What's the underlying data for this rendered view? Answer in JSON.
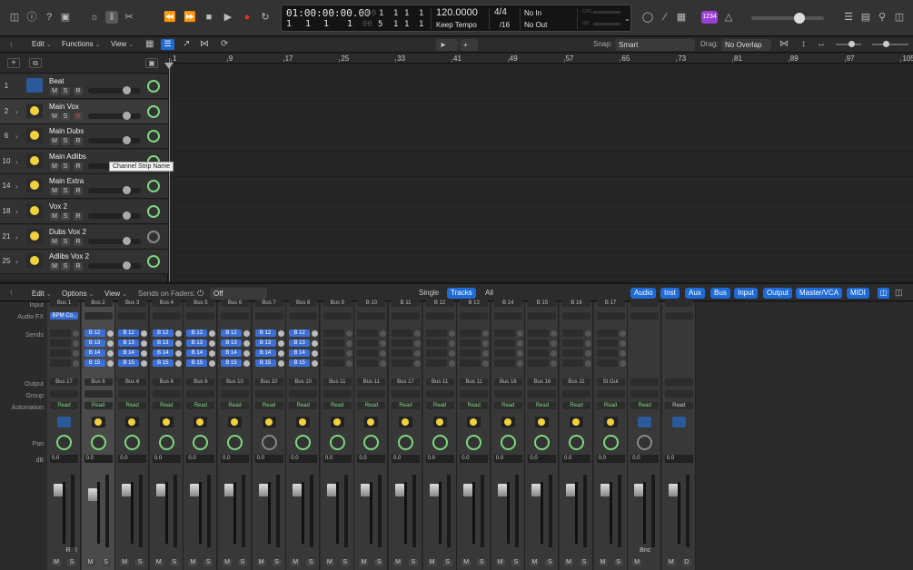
{
  "control_bar": {
    "lcd": {
      "smpte": "01:00:00:00.00",
      "smpte_dim": "000",
      "smpte_small": [
        "1",
        "1",
        "1",
        "1"
      ],
      "bars_dim": "000",
      "bars": [
        "1",
        "1",
        "1",
        "1"
      ],
      "bars_small_dim": "00",
      "bars_small": [
        "5",
        "1",
        "1",
        "1"
      ],
      "tempo": "120.0000",
      "tempo_mode": "Keep Tempo",
      "time_sig": "4/4",
      "division": "/16",
      "in": "No In",
      "out": "No Out",
      "cpu_labels": [
        "CPU",
        "HD"
      ]
    },
    "cpu_badge": "1234"
  },
  "arrange_toolbar": {
    "edit": "Edit",
    "functions": "Functions",
    "view": "View",
    "snap_label": "Snap:",
    "snap_value": "Smart",
    "drag_label": "Drag:",
    "drag_value": "No Overlap"
  },
  "ruler": {
    "bars": [
      "1",
      "9",
      "17",
      "25",
      "33",
      "41",
      "49",
      "57",
      "65",
      "73",
      "81",
      "89",
      "97",
      "105"
    ]
  },
  "tracks": [
    {
      "num": "1",
      "name": "Beat",
      "icon": "waveform",
      "selected": false
    },
    {
      "num": "2",
      "name": "Main Vox",
      "icon": "mic",
      "selected": true
    },
    {
      "num": "6",
      "name": "Main Dubs",
      "icon": "mic",
      "selected": false
    },
    {
      "num": "10",
      "name": "Main Adlibs",
      "icon": "mic",
      "selected": false
    },
    {
      "num": "14",
      "name": "Main Extra",
      "icon": "mic",
      "selected": false
    },
    {
      "num": "18",
      "name": "Vox 2",
      "icon": "mic",
      "selected": false
    },
    {
      "num": "21",
      "name": "Dubs Vox 2",
      "icon": "mic",
      "selected": false
    },
    {
      "num": "25",
      "name": "Adlibs Vox 2",
      "icon": "mic",
      "selected": false
    }
  ],
  "track_buttons": {
    "mute": "M",
    "solo": "S",
    "record": "R"
  },
  "tooltip": "Channel Strip Name",
  "mixer_toolbar": {
    "edit": "Edit",
    "options": "Options",
    "view": "View",
    "sends_on_faders_label": "Sends on Faders:",
    "sends_on_faders_value": "Off",
    "scope": [
      "Single",
      "Tracks",
      "All"
    ],
    "scope_active": "Tracks",
    "filters": [
      "Audio",
      "Inst",
      "Aux",
      "Bus",
      "Input",
      "Output",
      "Master/VCA",
      "MIDI"
    ]
  },
  "mixer_labels": [
    "Input",
    "Audio FX",
    "Sends",
    "Output",
    "Group",
    "Automation",
    "Pan",
    "dB"
  ],
  "strips": [
    {
      "input": "Bus 1",
      "fx": "BPM Co..",
      "sends": [],
      "output": "Bus 17",
      "auto": "Read",
      "icon": "waveform",
      "pan_active": true,
      "db": "0.0",
      "bottom": [
        "M",
        "S"
      ],
      "ri": true
    },
    {
      "input": "Bus 2",
      "fx": "",
      "sends": [
        "B 12",
        "B 13",
        "B 14",
        "B 15"
      ],
      "output": "Bus 6",
      "auto": "Read",
      "icon": "mic",
      "pan_active": true,
      "db": "0.0",
      "bottom": [
        "M",
        "S"
      ],
      "selected": true
    },
    {
      "input": "Bus 3",
      "fx": "",
      "sends": [
        "B 12",
        "B 13",
        "B 14",
        "B 15"
      ],
      "output": "Bus 6",
      "auto": "Read",
      "icon": "mic",
      "pan_active": true,
      "db": "0.0",
      "bottom": [
        "M",
        "S"
      ]
    },
    {
      "input": "Bus 4",
      "fx": "",
      "sends": [
        "B 12",
        "B 13",
        "B 14",
        "B 15"
      ],
      "output": "Bus 6",
      "auto": "Read",
      "icon": "mic",
      "pan_active": true,
      "db": "0.0",
      "bottom": [
        "M",
        "S"
      ]
    },
    {
      "input": "Bus 5",
      "fx": "",
      "sends": [
        "B 12",
        "B 13",
        "B 14",
        "B 15"
      ],
      "output": "Bus 6",
      "auto": "Read",
      "icon": "mic",
      "pan_active": true,
      "db": "0.0",
      "bottom": [
        "M",
        "S"
      ]
    },
    {
      "input": "Bus 6",
      "fx": "",
      "sends": [
        "B 12",
        "B 13",
        "B 14",
        "B 15"
      ],
      "output": "Bus 10",
      "auto": "Read",
      "icon": "mic",
      "pan_active": true,
      "db": "0.0",
      "bottom": [
        "M",
        "S"
      ]
    },
    {
      "input": "Bus 7",
      "fx": "",
      "sends": [
        "B 12",
        "B 13",
        "B 14",
        "B 15"
      ],
      "output": "Bus 10",
      "auto": "Read",
      "icon": "mic",
      "pan_active": false,
      "db": "0.0",
      "bottom": [
        "M",
        "S"
      ]
    },
    {
      "input": "Bus 8",
      "fx": "",
      "sends": [
        "B 12",
        "B 13",
        "B 14",
        "B 15"
      ],
      "output": "Bus 10",
      "auto": "Read",
      "icon": "mic",
      "pan_active": true,
      "db": "0.0",
      "bottom": [
        "M",
        "S"
      ]
    },
    {
      "input": "Bus 9",
      "fx": "",
      "sends": [],
      "output": "Bus 11",
      "auto": "Read",
      "icon": "mic",
      "pan_active": true,
      "db": "0.0",
      "bottom": [
        "M",
        "S"
      ]
    },
    {
      "input": "B 10",
      "fx": "",
      "sends": [],
      "output": "Bus 11",
      "auto": "Read",
      "icon": "mic",
      "pan_active": true,
      "db": "0.0",
      "bottom": [
        "M",
        "S"
      ]
    },
    {
      "input": "B 11",
      "fx": "",
      "sends": [],
      "output": "Bus 17",
      "auto": "Read",
      "icon": "mic",
      "pan_active": true,
      "db": "0.0",
      "bottom": [
        "M",
        "S"
      ]
    },
    {
      "input": "B 12",
      "fx": "",
      "sends": [],
      "output": "Bus 11",
      "auto": "Read",
      "icon": "mic",
      "pan_active": true,
      "db": "0.0",
      "bottom": [
        "M",
        "S"
      ]
    },
    {
      "input": "B 13",
      "fx": "",
      "sends": [],
      "output": "Bus 11",
      "auto": "Read",
      "icon": "mic",
      "pan_active": true,
      "db": "0.0",
      "bottom": [
        "M",
        "S"
      ]
    },
    {
      "input": "B 14",
      "fx": "",
      "sends": [],
      "output": "Bus 16",
      "auto": "Read",
      "icon": "mic",
      "pan_active": true,
      "db": "0.0",
      "bottom": [
        "M",
        "S"
      ]
    },
    {
      "input": "B 15",
      "fx": "",
      "sends": [],
      "output": "Bus 16",
      "auto": "Read",
      "icon": "mic",
      "pan_active": true,
      "db": "0.0",
      "bottom": [
        "M",
        "S"
      ]
    },
    {
      "input": "B 16",
      "fx": "",
      "sends": [],
      "output": "Bus 11",
      "auto": "Read",
      "icon": "mic",
      "pan_active": true,
      "db": "0.0",
      "bottom": [
        "M",
        "S"
      ]
    },
    {
      "input": "B 17",
      "fx": "",
      "sends": [],
      "output": "St Out",
      "auto": "Read",
      "icon": "mic",
      "pan_active": true,
      "db": "0.0",
      "bottom": [
        "M",
        "S"
      ]
    },
    {
      "input": "",
      "fx": "",
      "sends": [],
      "output": "",
      "auto": "Read",
      "icon": "waveform",
      "pan_active": false,
      "db": "0.0",
      "bottom": [
        "M"
      ],
      "bnc": "Bnc"
    },
    {
      "input": "",
      "fx": "",
      "sends": [],
      "output": "",
      "auto": "Read",
      "icon": "waveform",
      "pan_active": false,
      "db": "0.0",
      "bottom": [
        "M",
        "D"
      ],
      "grey_auto": true,
      "no_pan": true
    }
  ],
  "colors": {
    "accent": "#1f6bd6",
    "pan": "#7ed77e",
    "track_icon": "#f0d23c",
    "cpu": "#9b3fd4"
  }
}
